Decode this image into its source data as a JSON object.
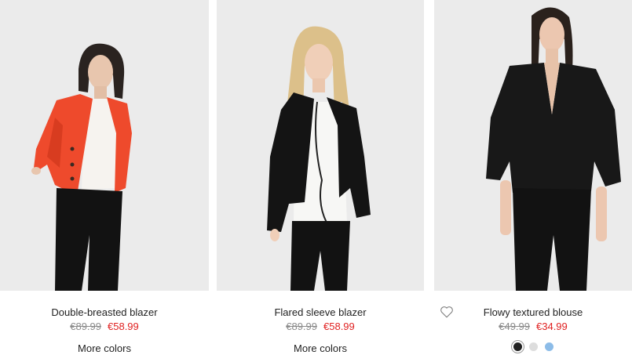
{
  "products": [
    {
      "name": "Double-breasted blazer",
      "old_price": "€89.99",
      "new_price": "€58.99",
      "more_colors": "More colors"
    },
    {
      "name": "Flared sleeve blazer",
      "old_price": "€89.99",
      "new_price": "€58.99",
      "more_colors": "More colors"
    },
    {
      "name": "Flowy textured blouse",
      "old_price": "€49.99",
      "new_price": "€34.99",
      "swatches": [
        "#222222",
        "#dddddd",
        "#8cbce8"
      ],
      "favorite_icon": "heart-outline-icon"
    }
  ],
  "colors": {
    "sale_price": "#e02020",
    "old_price": "#8a8a8a",
    "photo_background": "#ebebeb"
  }
}
